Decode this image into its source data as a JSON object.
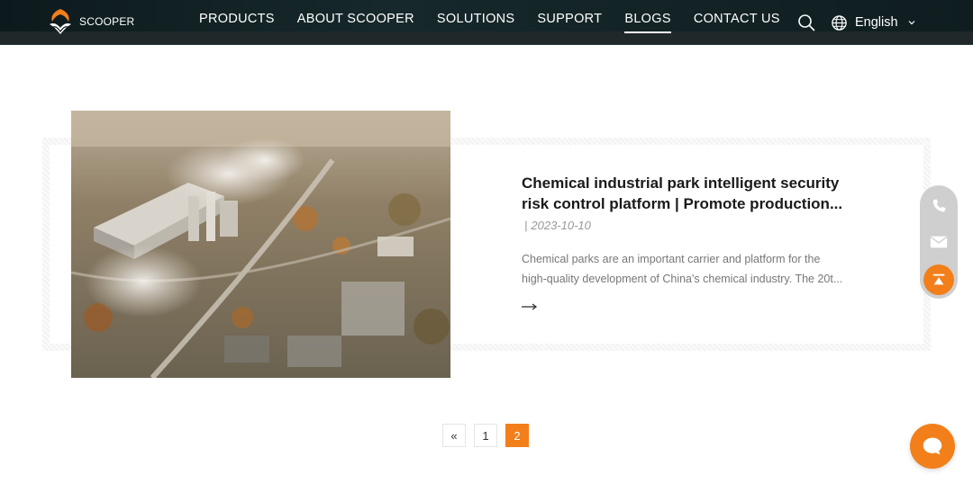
{
  "brand": {
    "name": "SCOOPER"
  },
  "nav": {
    "items": [
      {
        "label": "PRODUCTS"
      },
      {
        "label": "ABOUT SCOOPER"
      },
      {
        "label": "SOLUTIONS"
      },
      {
        "label": "SUPPORT"
      },
      {
        "label": "BLOGS",
        "active": true
      },
      {
        "label": "CONTACT US"
      }
    ],
    "language": "English"
  },
  "article": {
    "title_line1": "Chemical industrial park intelligent security",
    "title_line2": "risk control platform | Promote production...",
    "date_separator": "|",
    "date": "2023-10-10",
    "excerpt_line1": "Chemical parks are an important carrier and platform for the",
    "excerpt_line2": "high-quality development of China's chemical industry. The 20t..."
  },
  "pagination": {
    "prev": "«",
    "pages": [
      "1",
      "2"
    ],
    "current": "2"
  },
  "colors": {
    "accent": "#f27f1a",
    "header_bg": "#0f1d20"
  },
  "icons": {
    "search": "search-icon",
    "globe": "globe-icon",
    "chevron": "chevron-down-icon",
    "phone": "phone-icon",
    "mail": "mail-icon",
    "top": "back-to-top-icon",
    "chat": "chat-icon",
    "arrow": "arrow-right-icon"
  }
}
